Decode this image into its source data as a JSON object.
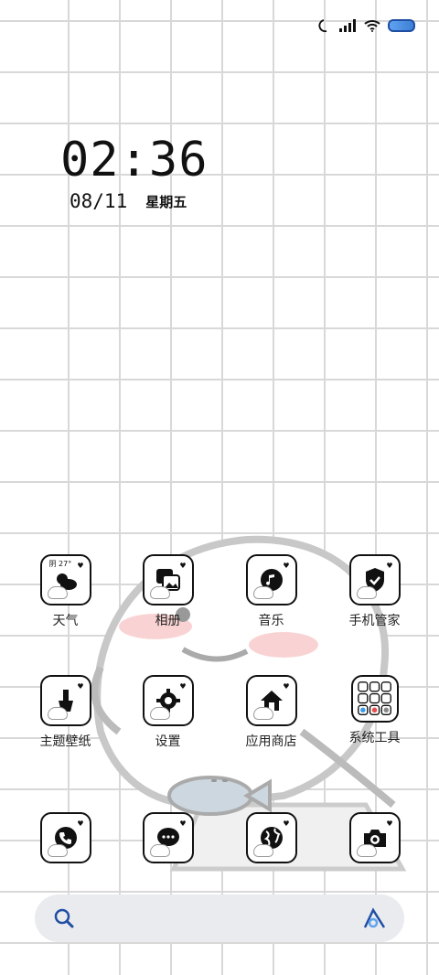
{
  "status_bar": {
    "icons": [
      "moon-icon",
      "signal-icon",
      "wifi-icon",
      "battery-icon"
    ]
  },
  "clock": {
    "time": "02:36",
    "date": "08/11",
    "weekday": "星期五"
  },
  "apps": [
    {
      "name": "weather",
      "label": "天气",
      "icon": "weather-icon",
      "weather_text": "阴 27°"
    },
    {
      "name": "gallery",
      "label": "相册",
      "icon": "gallery-icon"
    },
    {
      "name": "music",
      "label": "音乐",
      "icon": "music-icon"
    },
    {
      "name": "security",
      "label": "手机管家",
      "icon": "shield-check-icon"
    },
    {
      "name": "themes",
      "label": "主题壁纸",
      "icon": "brush-icon"
    },
    {
      "name": "settings",
      "label": "设置",
      "icon": "gear-icon"
    },
    {
      "name": "app-store",
      "label": "应用商店",
      "icon": "home-icon"
    },
    {
      "name": "system-tools",
      "label": "系统工具",
      "icon": "folder-grid-icon"
    }
  ],
  "dock": [
    {
      "name": "phone",
      "icon": "phone-icon"
    },
    {
      "name": "messages",
      "icon": "chat-icon"
    },
    {
      "name": "browser",
      "icon": "globe-icon"
    },
    {
      "name": "camera",
      "icon": "camera-icon"
    }
  ],
  "search": {
    "left_icon": "search-icon",
    "right_icon": "assistant-icon"
  },
  "colors": {
    "battery": "#3d7fd6",
    "search_icon": "#1f4ea3"
  }
}
